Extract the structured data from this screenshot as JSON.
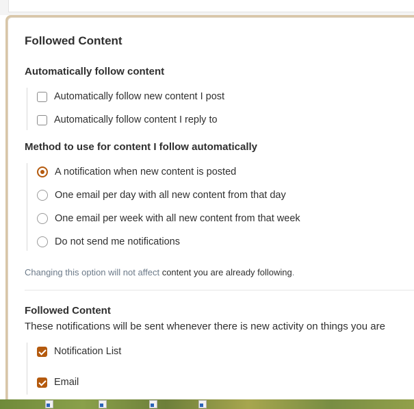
{
  "panel": {
    "title": "Followed Content",
    "auto_follow": {
      "heading": "Automatically follow content",
      "options": [
        {
          "label": "Automatically follow new content I post",
          "checked": false
        },
        {
          "label": "Automatically follow content I reply to",
          "checked": false
        }
      ]
    },
    "method": {
      "heading": "Method to use for content I follow automatically",
      "options": [
        {
          "label": "A notification when new content is posted",
          "selected": true
        },
        {
          "label": "One email per day with all new content from that day",
          "selected": false
        },
        {
          "label": "One email per week with all new content from that week",
          "selected": false
        },
        {
          "label": "Do not send me notifications",
          "selected": false
        }
      ]
    },
    "note": {
      "muted": "Changing this option will not affect",
      "dark": "content you are already following",
      "end": "."
    },
    "followed": {
      "heading": "Followed Content",
      "description": "These notifications will be sent whenever there is new activity on things you are",
      "options": [
        {
          "label": "Notification List",
          "checked": true
        },
        {
          "label": "Email",
          "checked": true
        }
      ]
    }
  },
  "colors": {
    "accent": "#b45a0e",
    "muted_text": "#6c7a89",
    "text": "#2f2f2f"
  },
  "icons": {
    "checkbox": "checkbox-icon",
    "radio": "radio-icon",
    "taskbar_shortcut": "shortcut-icon"
  }
}
